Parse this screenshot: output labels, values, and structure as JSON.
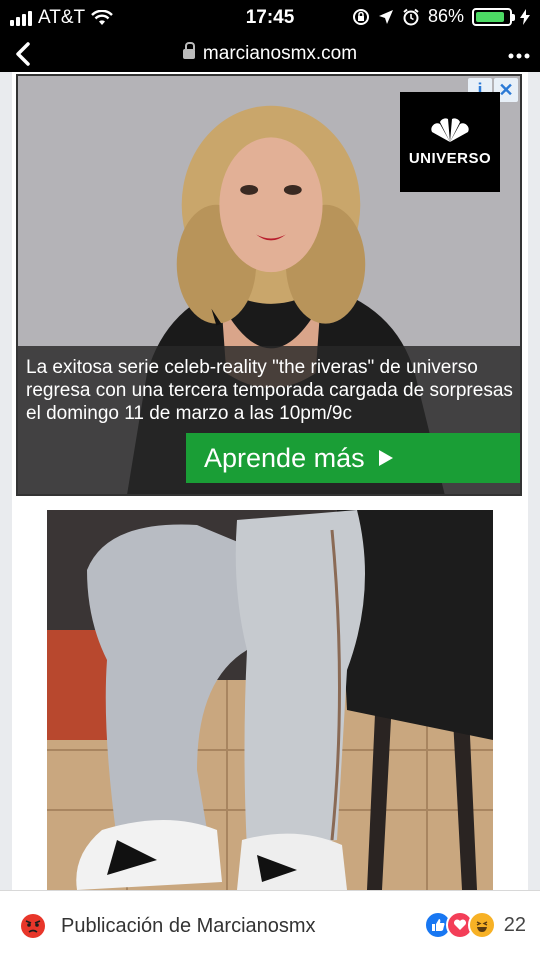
{
  "status_bar": {
    "carrier": "AT&T",
    "time": "17:45",
    "battery_percent": "86%",
    "battery_level": 0.86
  },
  "browser": {
    "url": "marcianosmx.com"
  },
  "ad": {
    "logo_text": "UNIVERSO",
    "info_badge": "i",
    "close_badge": "✕",
    "text": "La exitosa serie celeb-reality \"the riveras\" de universo regresa con una tercera temporada cargada de sorpresas el domingo 11 de marzo a las 10pm/9c",
    "cta_label": "Aprende más"
  },
  "post": {
    "publication_label": "Publicación de Marcianosmx",
    "reaction_count": "22"
  },
  "colors": {
    "cta_green": "#1a9e36",
    "battery_green": "#4cd964",
    "like_blue": "#1877f2",
    "love_red": "#f33e58",
    "haha_yellow": "#f7b125"
  }
}
